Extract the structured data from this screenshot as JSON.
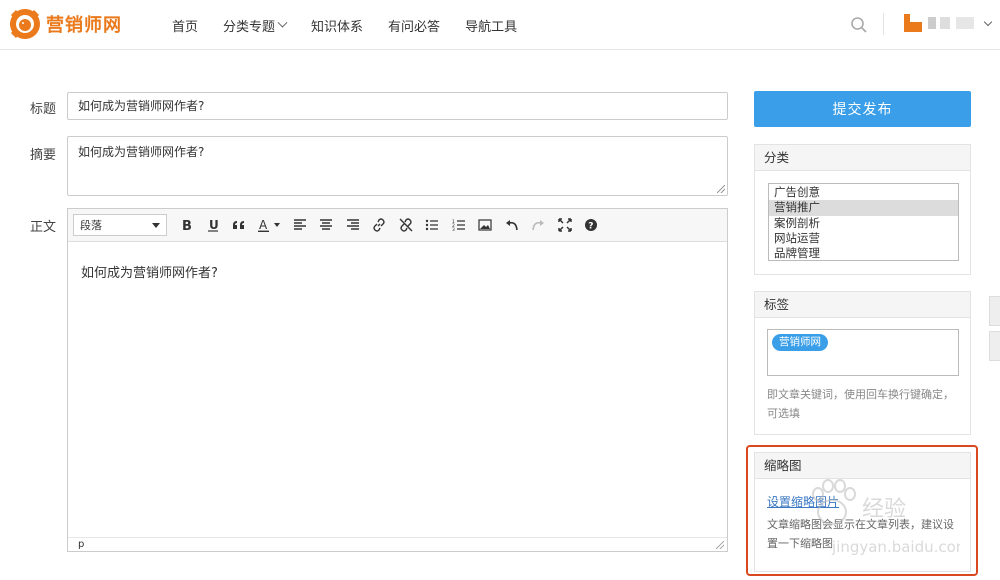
{
  "header": {
    "logo_text": "营销师网",
    "nav": [
      {
        "label": "首页"
      },
      {
        "label": "分类专题"
      },
      {
        "label": "知识体系"
      },
      {
        "label": "有问必答"
      },
      {
        "label": "导航工具"
      }
    ]
  },
  "form": {
    "title_label": "标题",
    "title_value": "如何成为营销师网作者?",
    "summary_label": "摘要",
    "summary_value": "如何成为营销师网作者?",
    "body_label": "正文",
    "format_select": "段落",
    "editor_content": "如何成为营销师网作者?",
    "status_path": "p"
  },
  "sidebar": {
    "submit_label": "提交发布",
    "category": {
      "title": "分类",
      "items": [
        "广告创意",
        "营销推广",
        "案例剖析",
        "网站运营",
        "品牌管理"
      ],
      "selected_index": 1
    },
    "tags": {
      "title": "标签",
      "chips": [
        "营销师网"
      ],
      "hint": "即文章关键词，使用回车换行键确定，可选填"
    },
    "thumbnail": {
      "title": "缩略图",
      "link": "设置缩略图片",
      "desc": "文章缩略图会显示在文章列表，建议设置一下缩略图"
    }
  },
  "watermark": {
    "text": "经验",
    "domain": "jingyan.baidu.com"
  },
  "colors": {
    "brand": "#ea7a1c",
    "primary": "#3a9fe8",
    "highlight": "#d9481e"
  }
}
